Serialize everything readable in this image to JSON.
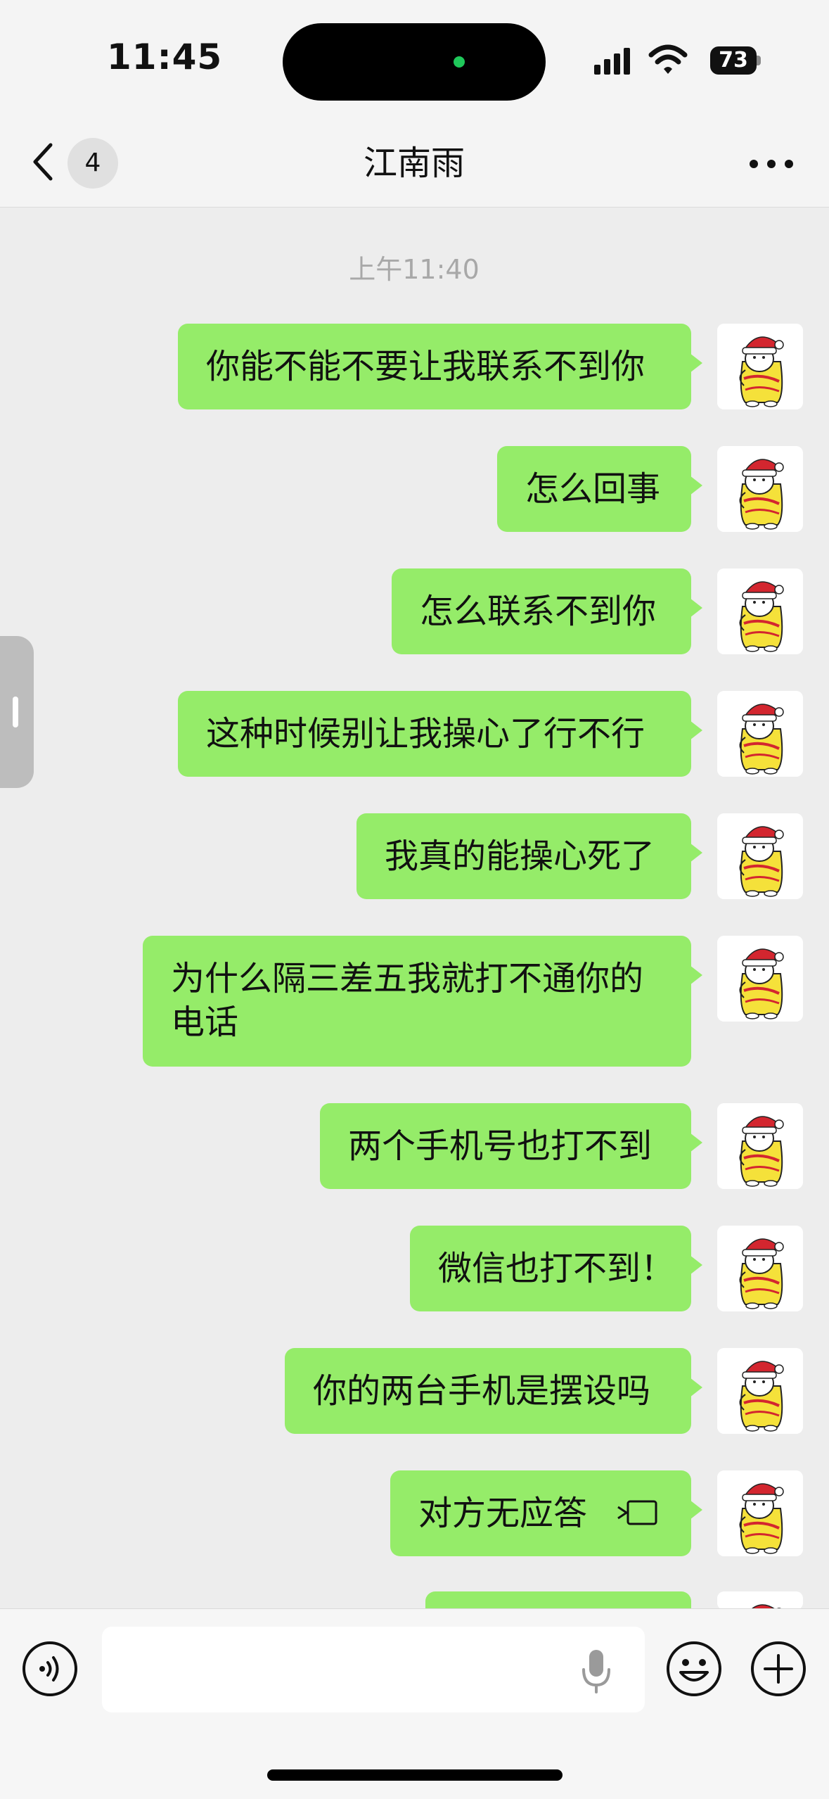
{
  "status_bar": {
    "time": "11:45",
    "battery": "73"
  },
  "nav": {
    "unread_count": "4",
    "title": "江南雨"
  },
  "conversation": {
    "timestamp": "上午11:40",
    "messages": [
      {
        "text": "你能不能不要让我联系不到你"
      },
      {
        "text": "怎么回事"
      },
      {
        "text": "怎么联系不到你"
      },
      {
        "text": "这种时候别让我操心了行不行"
      },
      {
        "text": "我真的能操心死了"
      },
      {
        "text": "为什么隔三差五我就打不通你的电话"
      },
      {
        "text": "两个手机号也打不到"
      },
      {
        "text": "微信也打不到！"
      },
      {
        "text": "你的两台手机是摆设吗"
      },
      {
        "text": "对方无应答",
        "icon": "video-call-icon"
      }
    ]
  },
  "colors": {
    "bubble": "#95ec69",
    "background": "#ededed"
  }
}
